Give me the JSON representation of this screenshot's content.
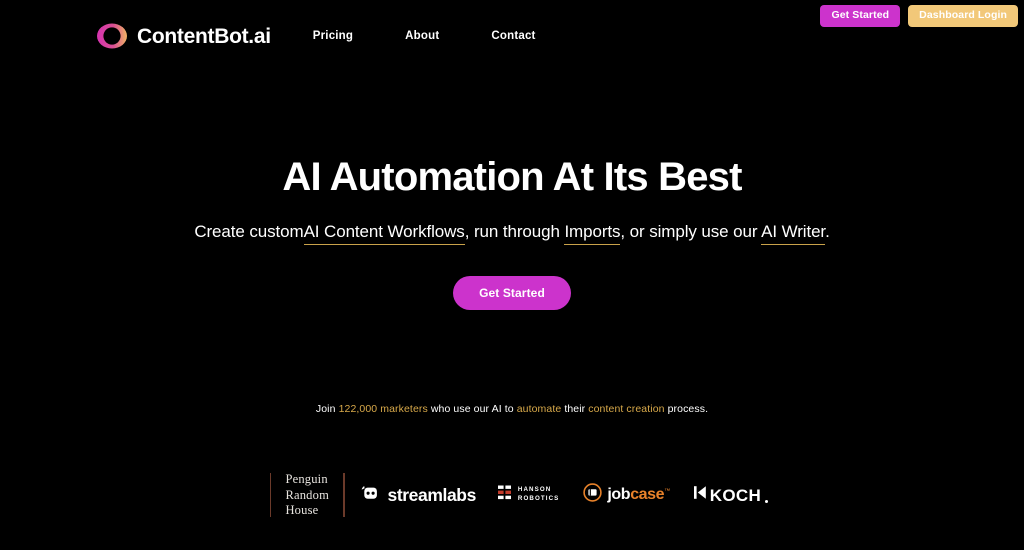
{
  "brand": {
    "name": "ContentBot.ai",
    "logo_icon": "ring-gradient-icon",
    "logo_gradient_from": "#d633b0",
    "logo_gradient_to": "#f0b464"
  },
  "nav": {
    "items": [
      {
        "label": "Pricing"
      },
      {
        "label": "About"
      },
      {
        "label": "Contact"
      }
    ]
  },
  "auth": {
    "get_started_label": "Get Started",
    "get_started_color": "#cc33cc",
    "dashboard_login_label": "Dashboard Login",
    "dashboard_login_color": "#f2c879"
  },
  "hero": {
    "title": "AI Automation At Its Best",
    "sub": {
      "part1": "Create custom",
      "link1": "AI Content Workflows",
      "part2": ", run through ",
      "link2": "Imports",
      "part3": ", or simply use our ",
      "link3": "AI Writer",
      "part4": "."
    },
    "cta_label": "Get Started",
    "cta_color": "#cc33cc",
    "underline_color": "#c9a24a"
  },
  "social_proof": {
    "part1": "Join ",
    "count": "122,000 marketers",
    "part2": " who use our AI to ",
    "highlight1": "automate",
    "part3": " their ",
    "highlight2": "content creation",
    "part4": " process.",
    "highlight_color": "#d8a94a"
  },
  "logos": {
    "divider_color": "#6b3a2a",
    "penguin": {
      "line1": "Penguin",
      "line2": "Random",
      "line3": "House"
    },
    "streamlabs": {
      "name": "streamlabs",
      "icon": "streamlabs-icon"
    },
    "hanson": {
      "line1": "HANSON",
      "line2": "ROBOTICS",
      "icon": "hanson-grid-icon"
    },
    "jobcase": {
      "word1": "job",
      "word2": "case",
      "tm": "™",
      "icon": "jobcase-circle-icon"
    },
    "koch": {
      "name": "KOCH",
      "icon": "koch-bars-icon"
    }
  }
}
